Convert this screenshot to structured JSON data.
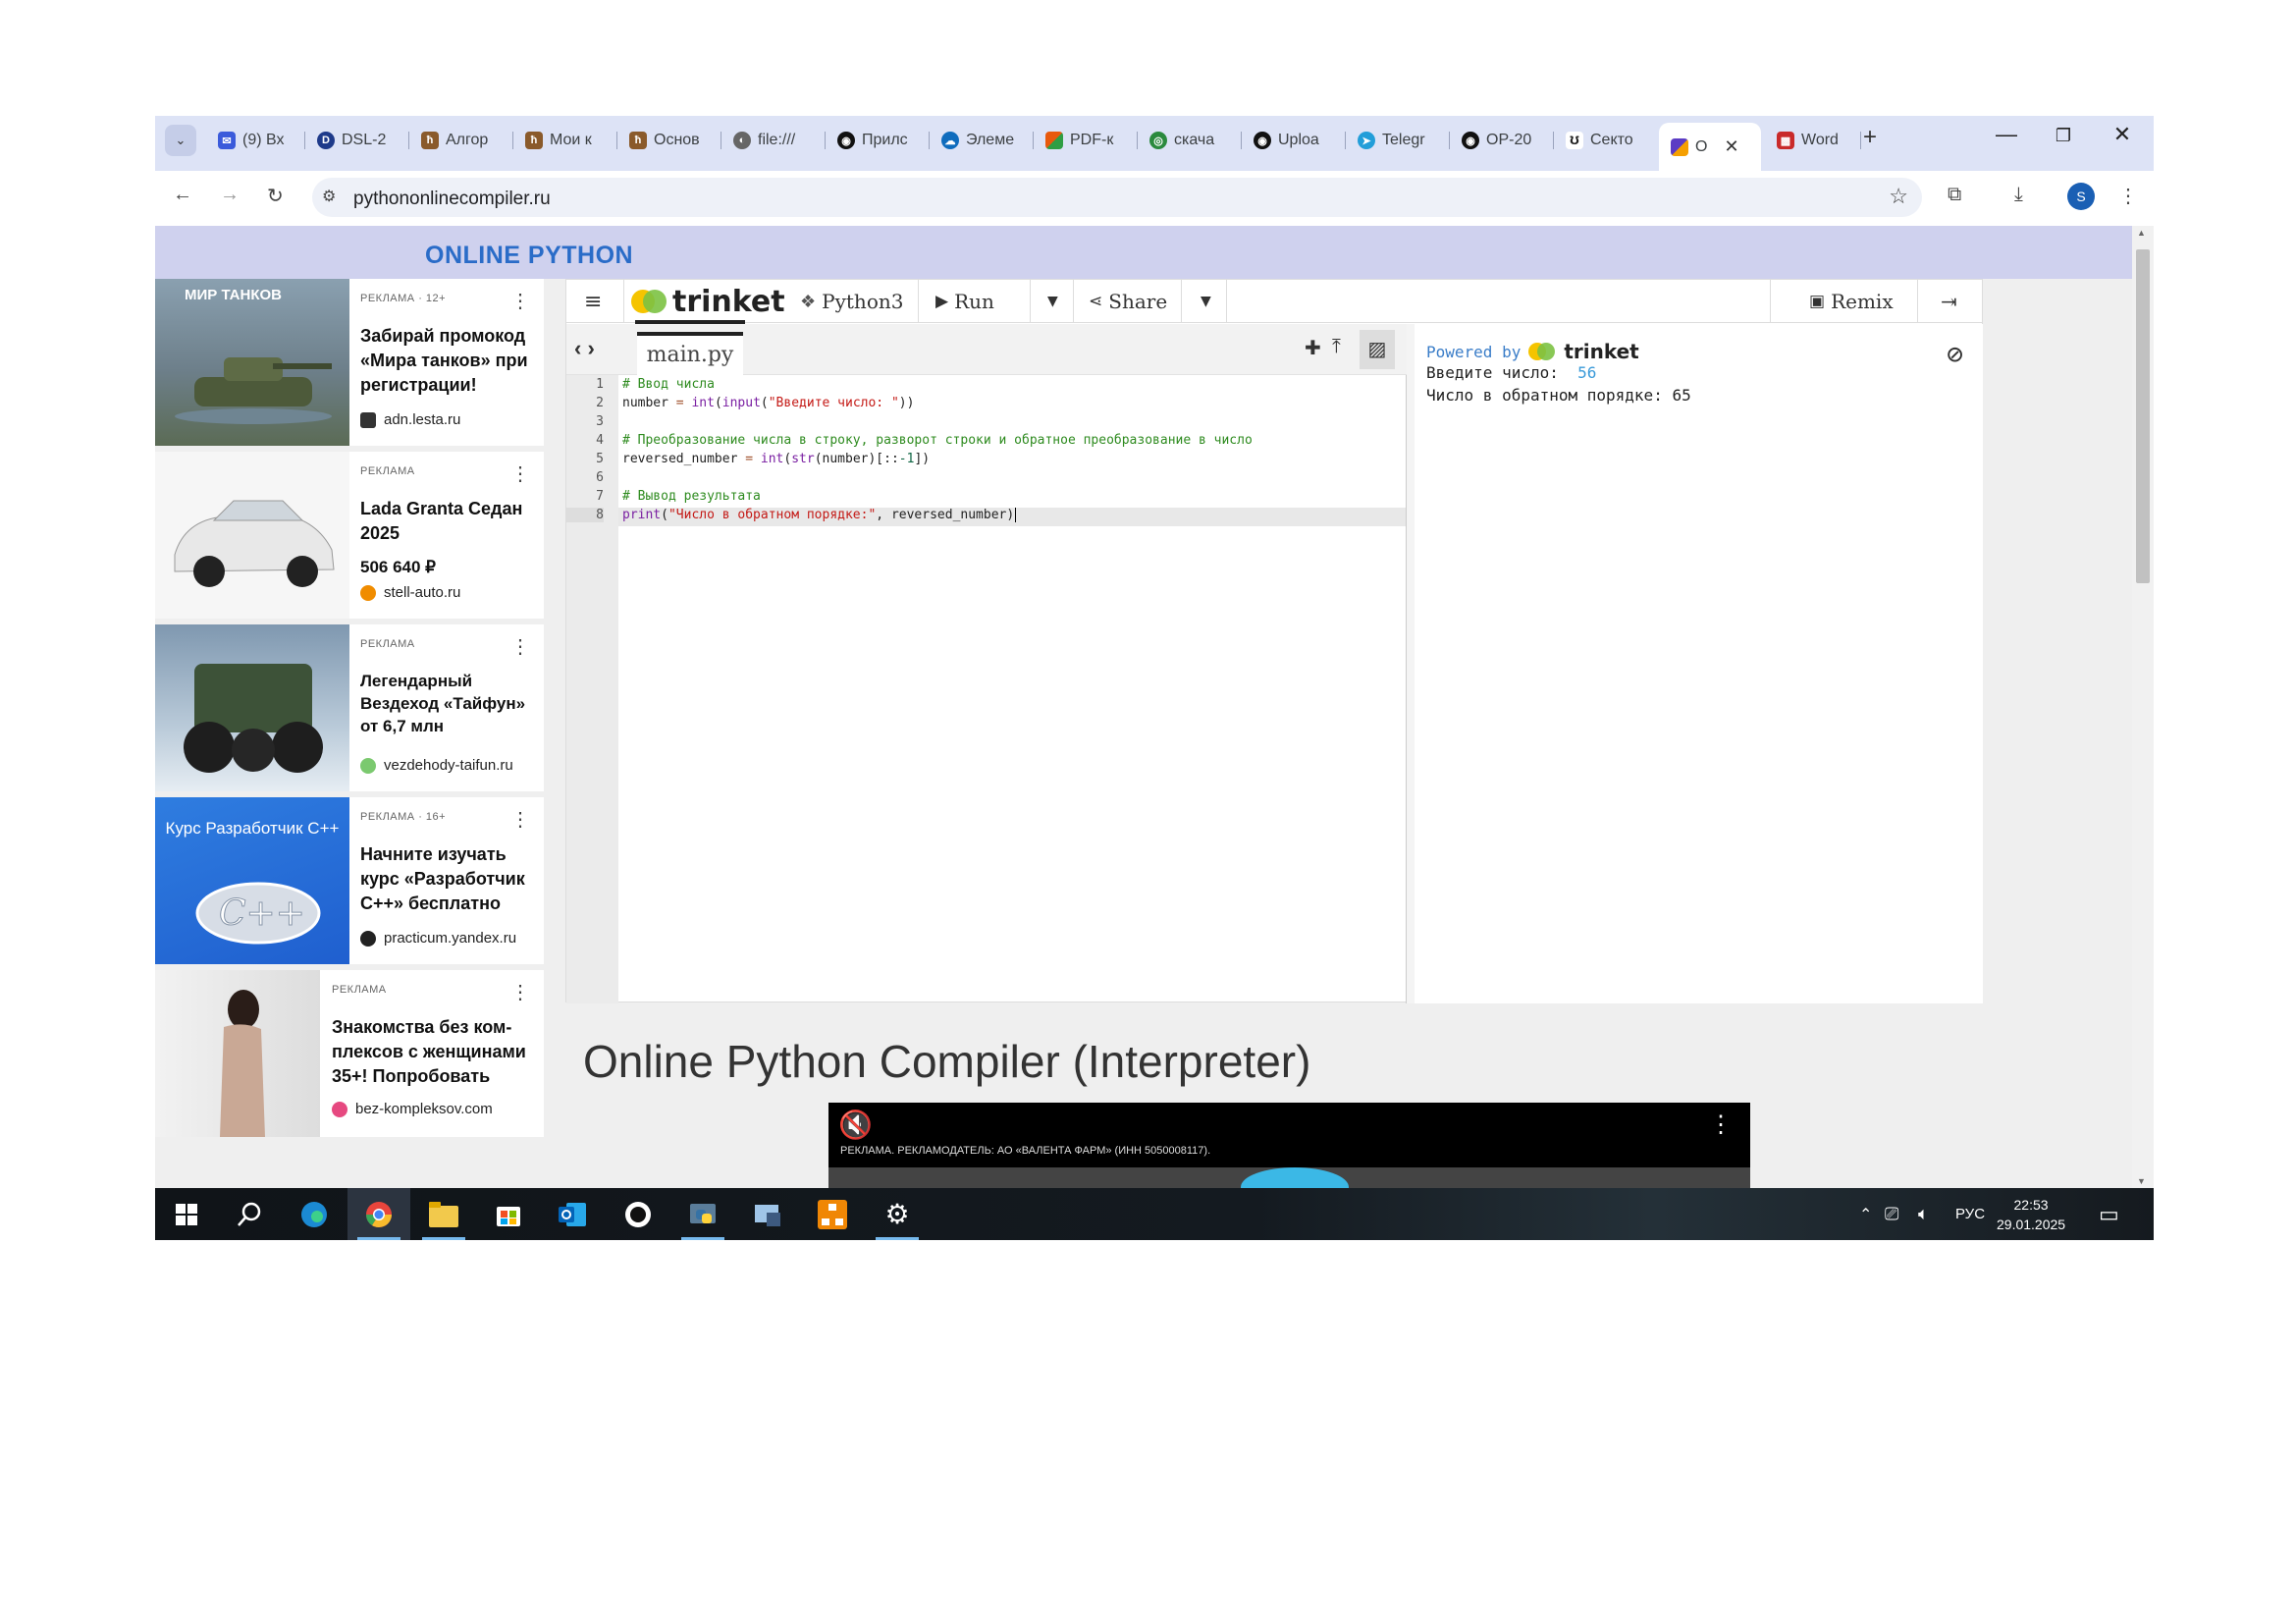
{
  "browser": {
    "tabs": [
      {
        "label": "(9) Вх",
        "favicon_color": "#3b5bdb",
        "favicon_glyph": "✉"
      },
      {
        "label": "DSL-2",
        "favicon_color": "#1e3a8a",
        "favicon_glyph": "D"
      },
      {
        "label": "Алгор",
        "favicon_color": "#8a5a2b",
        "favicon_glyph": "ћ"
      },
      {
        "label": "Мои к",
        "favicon_color": "#8a5a2b",
        "favicon_glyph": "ћ"
      },
      {
        "label": "Основ",
        "favicon_color": "#8a5a2b",
        "favicon_glyph": "ћ"
      },
      {
        "label": "file:///",
        "favicon_color": "#666666",
        "favicon_glyph": "◐"
      },
      {
        "label": "Прилс",
        "favicon_color": "#111111",
        "favicon_glyph": "◉"
      },
      {
        "label": "Элеме",
        "favicon_color": "#0f6cbd",
        "favicon_glyph": "☁"
      },
      {
        "label": "PDF-к",
        "favicon_color": "#d9480f",
        "favicon_glyph": "▦"
      },
      {
        "label": "скача",
        "favicon_color": "#2b8a3e",
        "favicon_glyph": "◎"
      },
      {
        "label": "Uploa",
        "favicon_color": "#111111",
        "favicon_glyph": "◉"
      },
      {
        "label": "Telegr",
        "favicon_color": "#229ed9",
        "favicon_glyph": "➤"
      },
      {
        "label": "OP-20",
        "favicon_color": "#111111",
        "favicon_glyph": "◉"
      },
      {
        "label": "Секто",
        "favicon_color": "#222222",
        "favicon_glyph": "ʊ"
      },
      {
        "label": "О",
        "favicon_color": "#5b3cc4",
        "favicon_glyph": "▚",
        "active": true
      },
      {
        "label": "Word",
        "favicon_color": "#c92a2a",
        "favicon_glyph": "▩"
      }
    ],
    "url": "pythononlinecompiler.ru",
    "profile_initial": "S"
  },
  "site": {
    "title": "ONLINE PYTHON",
    "heading": "Online Python Compiler (Interpreter)"
  },
  "ads": [
    {
      "meta": "РЕКЛАМА · 12+",
      "title": "Забирай промокод «Мира танков» при регистрации!",
      "domain": "adn.lesta.ru",
      "image_text": "МИР ТАНКОВ",
      "image_color": "#6a7f8c"
    },
    {
      "meta": "РЕКЛАМА",
      "title": "Lada Granta Седан 2025",
      "price": "506 640 ₽",
      "domain": "stell-auto.ru",
      "image_color": "#f4f4f4"
    },
    {
      "meta": "РЕКЛАМА",
      "title": "Легендарный Вездеход «Тайфун» от 6,7 млн",
      "domain": "vezdehody-taifun.ru",
      "image_color": "#9bb3c9"
    },
    {
      "meta": "РЕКЛАМА · 16+",
      "title": "Начните изучать курс «Разработчик C++» бесплатно",
      "domain": "practicum.yandex.ru",
      "image_text": "Курс Разработчик C++",
      "image_color": "#1f64d8"
    },
    {
      "meta": "РЕКЛАМА",
      "title": "Знакомства без ком- плексов с женщинами 35+! Попробовать",
      "domain": "bez-kompleksov.com",
      "image_color": "#d9c9bd"
    }
  ],
  "trinket": {
    "logo": "trinket",
    "language": "Python3",
    "run": "Run",
    "share": "Share",
    "remix": "Remix",
    "file": "main.py",
    "line_numbers": [
      "1",
      "2",
      "3",
      "4",
      "5",
      "6",
      "7",
      "8"
    ],
    "code": [
      "# Ввод числа",
      "number = int(input(\"Введите число: \"))",
      "",
      "# Преобразование числа в строку, разворот строки и обратное преобразование в число",
      "reversed_number = int(str(number)[::-1])",
      "",
      "# Вывод результата",
      "print(\"Число в обратном порядке:\", reversed_number)"
    ],
    "output": {
      "powered_by": "Powered by",
      "powered_logo": "trinket",
      "prompt": "Введите число:",
      "input_value": "56",
      "result": "Число в обратном порядке: 65"
    }
  },
  "video_ad": {
    "caption": "РЕКЛАМА. РЕКЛАМОДАТЕЛЬ: АО «ВАЛЕНТА ФАРМ» (ИНН 5050008117)."
  },
  "taskbar": {
    "language": "РУС",
    "time": "22:53",
    "date": "29.01.2025"
  },
  "colors": {
    "tab_strip": "#dde3f6",
    "site_header": "#cfd1ee",
    "site_title": "#2a6cc8",
    "comment": "#2e8b1f",
    "string": "#c41a16"
  }
}
